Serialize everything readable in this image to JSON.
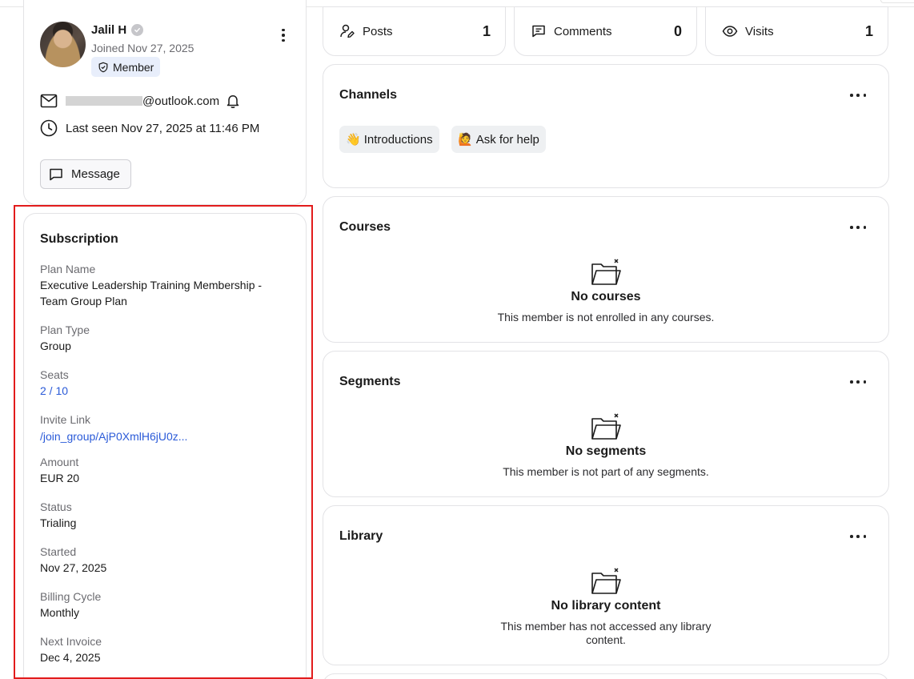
{
  "profile": {
    "name": "Jalil H",
    "joined": "Joined Nov 27, 2025",
    "role_badge": "Member",
    "email_domain": "@outlook.com",
    "last_seen": "Last seen Nov 27, 2025 at 11:46 PM",
    "message_label": "Message"
  },
  "subscription": {
    "title": "Subscription",
    "fields": [
      {
        "label": "Plan Name",
        "value": "Executive Leadership Training Membership - Team Group Plan"
      },
      {
        "label": "Plan Type",
        "value": "Group"
      },
      {
        "label": "Seats",
        "value": "2 / 10"
      },
      {
        "label": "Invite Link",
        "value": "/join_group/AjP0XmlH6jU0z..."
      },
      {
        "label": "Amount",
        "value": "EUR 20"
      },
      {
        "label": "Status",
        "value": "Trialing"
      },
      {
        "label": "Started",
        "value": "Nov 27, 2025"
      },
      {
        "label": "Billing Cycle",
        "value": "Monthly"
      },
      {
        "label": "Next Invoice",
        "value": "Dec 4, 2025"
      }
    ]
  },
  "stats": [
    {
      "label": "Posts",
      "value": "1",
      "icon": "user-edit-icon"
    },
    {
      "label": "Comments",
      "value": "0",
      "icon": "comment-icon"
    },
    {
      "label": "Visits",
      "value": "1",
      "icon": "eye-icon"
    }
  ],
  "channels": {
    "title": "Channels",
    "items": [
      {
        "emoji": "👋",
        "label": "Introductions"
      },
      {
        "emoji": "🙋",
        "label": "Ask for help"
      }
    ]
  },
  "courses": {
    "title": "Courses",
    "empty_title": "No courses",
    "empty_desc": "This member is not enrolled in any courses."
  },
  "segments": {
    "title": "Segments",
    "empty_title": "No segments",
    "empty_desc": "This member is not part of any segments."
  },
  "library": {
    "title": "Library",
    "empty_title": "No library content",
    "empty_desc": "This member has not accessed any library content."
  },
  "colors": {
    "accent_link": "#2a5ad8",
    "badge_bg": "#e8eefb",
    "highlight": "#e21c1c",
    "border": "#e3e3e6"
  }
}
